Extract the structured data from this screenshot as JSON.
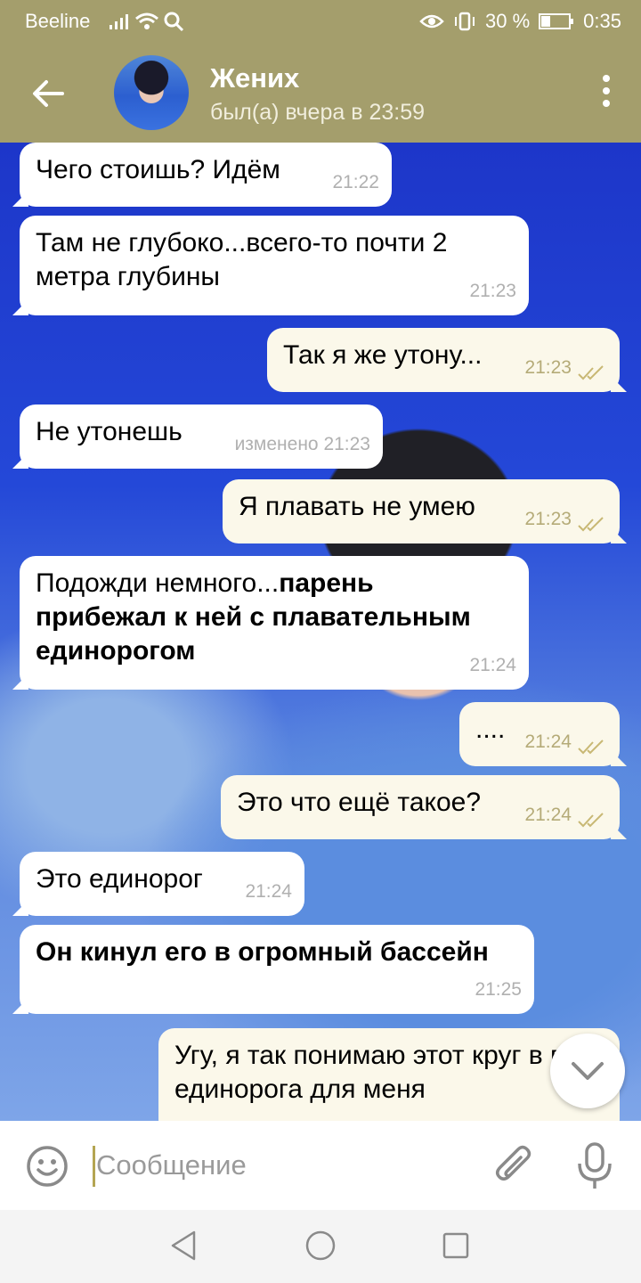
{
  "status_bar": {
    "carrier": "Beeline",
    "battery": "30 %",
    "time": "0:35"
  },
  "header": {
    "name": "Жених",
    "status": "был(а) вчера в 23:59"
  },
  "messages": [
    {
      "dir": "in",
      "text": "Чего стоишь? Идём",
      "time": "21:22"
    },
    {
      "dir": "in",
      "text": "Там не глубоко...всего-то почти 2 метра глубины",
      "time": "21:23"
    },
    {
      "dir": "out",
      "text": "Так я же утону...",
      "time": "21:23"
    },
    {
      "dir": "in",
      "text": "Не утонешь",
      "edited": "изменено",
      "time": "21:23"
    },
    {
      "dir": "out",
      "text": "Я плавать не умею",
      "time": "21:23"
    },
    {
      "dir": "in",
      "text_plain": "Подожди немного...",
      "text_bold": "парень прибежал к ней с плавательным единорогом",
      "time": "21:24"
    },
    {
      "dir": "out",
      "text": "....",
      "time": "21:24"
    },
    {
      "dir": "out",
      "text": "Это что ещё такое?",
      "time": "21:24"
    },
    {
      "dir": "in",
      "text": "Это единорог",
      "time": "21:24"
    },
    {
      "dir": "in",
      "text_bold": "Он кинул его в огромный бассейн",
      "time": "21:25"
    },
    {
      "dir": "out",
      "text": "Угу, я так понимаю этот круг в виде единорога для меня"
    }
  ],
  "input": {
    "placeholder": "Сообщение"
  },
  "colors": {
    "header": "#a49e6c",
    "incoming": "#ffffff",
    "outgoing": "#fbf8ea",
    "accent": "#b4a552"
  }
}
